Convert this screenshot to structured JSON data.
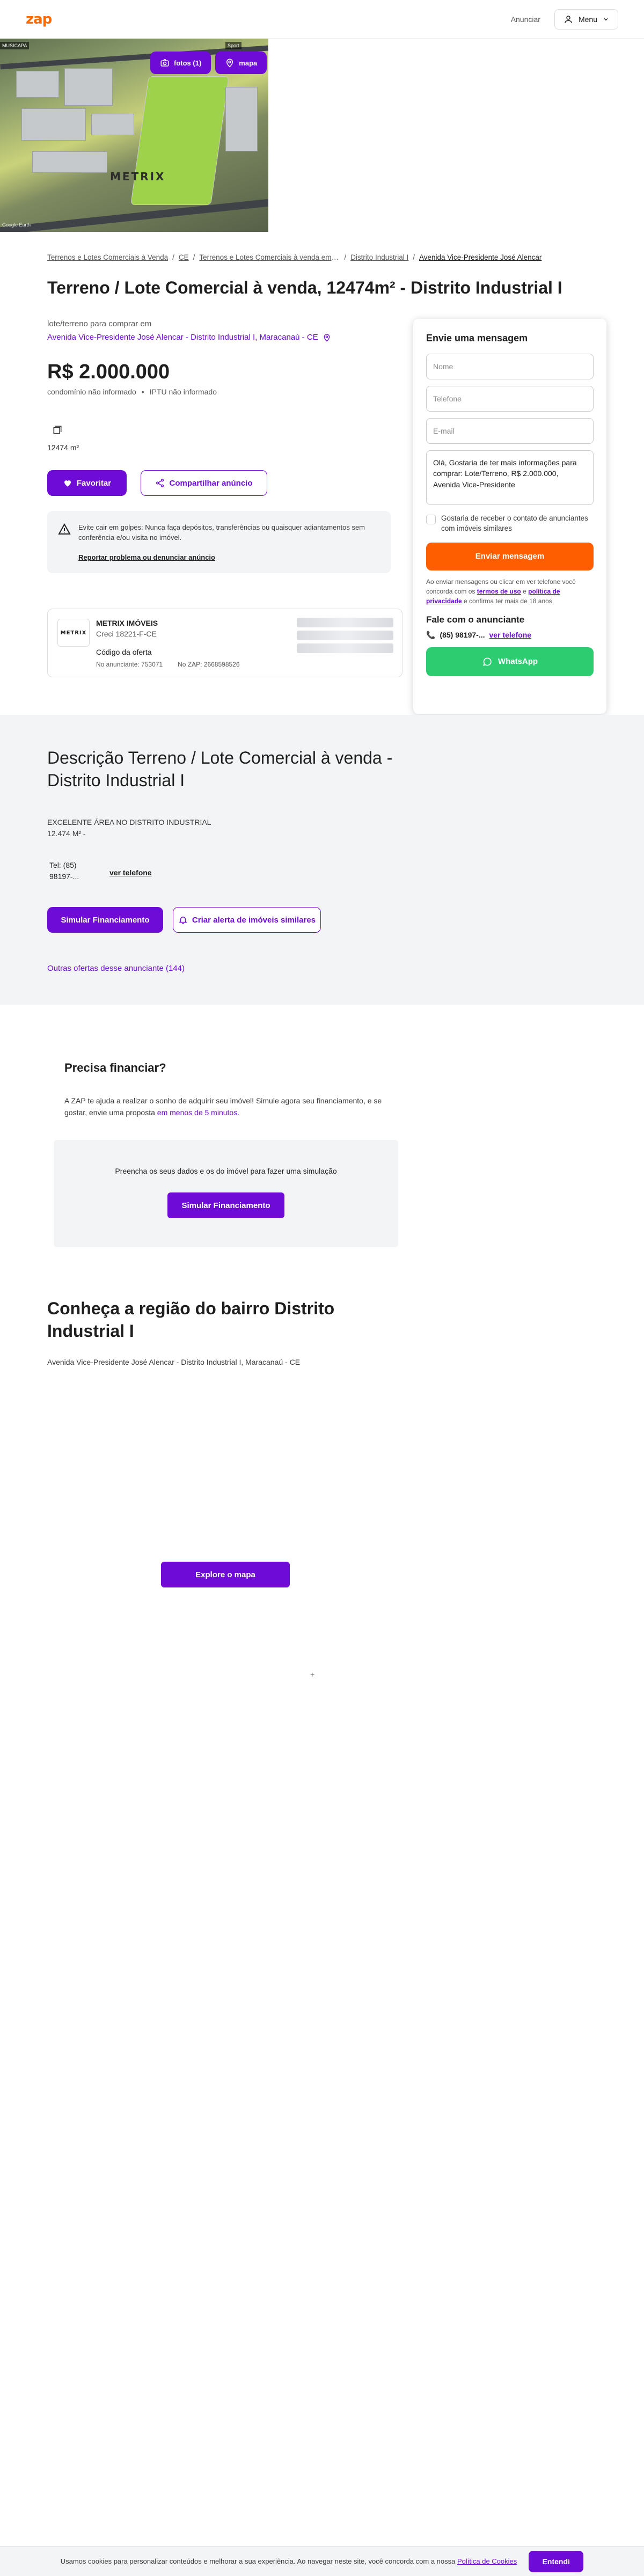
{
  "header": {
    "logo": "zap",
    "anunciar": "Anunciar",
    "menu": "Menu"
  },
  "photo": {
    "photos_button": "fotos (1)",
    "map_button": "mapa",
    "watermark": "METRIX",
    "corner_tag": "MUSICAPA",
    "corner_tag2": "Sport",
    "credit": "Google Earth"
  },
  "breadcrumb": [
    "Terrenos e Lotes Comerciais à Venda",
    "CE",
    "Terrenos e Lotes Comerciais à venda em Maracanaú",
    "Distrito Industrial I",
    "Avenida Vice-Presidente José Alencar"
  ],
  "breadcrumb_sep": "/",
  "listing": {
    "title": "Terreno / Lote Comercial à venda, 12474m² - Distrito Industrial I",
    "subtitle": "lote/terreno para comprar em",
    "address": "Avenida Vice-Presidente José Alencar - Distrito Industrial I, Maracanaú - CE",
    "price": "R$ 2.000.000",
    "condo": "condomínio não informado",
    "iptu": "IPTU não informado",
    "area": "12474 m²",
    "favorite": "Favoritar",
    "share": "Compartilhar anúncio"
  },
  "warning": {
    "text": "Evite cair em golpes: Nunca faça depósitos, transferências ou quaisquer adiantamentos sem conferência e/ou visita no imóvel.",
    "report": "Reportar problema ou denunciar anúncio"
  },
  "advertiser": {
    "logo": "METRIX",
    "name": "METRIX IMÓVEIS",
    "creci": "Creci 18221-F-CE",
    "code_label": "Código da oferta",
    "listing_code": "No anunciante: 753071",
    "zap_code": "No ZAP: 2668598526"
  },
  "contact": {
    "title": "Envie uma mensagem",
    "name_placeholder": "Nome",
    "phone_placeholder": "Telefone",
    "email_placeholder": "E-mail",
    "message": "Olá, Gostaria de ter mais informações para comprar: Lote/Terreno, R$ 2.000.000, Avenida Vice-Presidente",
    "similar_opt_in": "Gostaria de receber o contato de anunciantes com imóveis similares",
    "send": "Enviar mensagem",
    "legal_1": "Ao enviar mensagens ou clicar em ver telefone você concorda com os",
    "terms": "termos de uso",
    "legal_and": "e",
    "privacy": "política de privacidade",
    "legal_2": "e confirma ter mais de 18 anos.",
    "talk_title": "Fale com o anunciante",
    "phone": "(85) 98197-...",
    "see_phone": "ver telefone",
    "whatsapp": "WhatsApp"
  },
  "description": {
    "title": "Descrição Terreno / Lote Comercial à venda - Distrito Industrial I",
    "line1": "EXCELENTE ÁREA NO DISTRITO INDUSTRIAL",
    "line2": "12.474 M² -",
    "tel_label": "Tel: (85)",
    "tel_value": "98197-...",
    "see_phone": "ver telefone",
    "simulate": "Simular Financiamento",
    "alert": "Criar alerta de imóveis similares",
    "other_offers": "Outras ofertas desse anunciante (144)"
  },
  "financing": {
    "title": "Precisa financiar?",
    "text": "A ZAP te ajuda a realizar o sonho de adquirir seu imóvel! Simule agora seu financiamento, e se gostar, envie uma proposta",
    "highlight": "em menos de 5 minutos.",
    "box_text": "Preencha os seus dados e os do imóvel para fazer uma simulação",
    "simulate": "Simular Financiamento"
  },
  "region": {
    "title": "Conheça a região do bairro Distrito Industrial I",
    "address": "Avenida Vice-Presidente José Alencar - Distrito Industrial I, Maracanaú - CE",
    "explore": "Explore o mapa",
    "plus": "+"
  },
  "cookies": {
    "text": "Usamos cookies para personalizar conteúdos e melhorar a sua experiência. Ao navegar neste site, você concorda com a nossa",
    "link": "Política de Cookies",
    "accept": "Entendi"
  },
  "colors": {
    "brand_purple": "#6f0bd6",
    "brand_orange": "#ff5e00",
    "whatsapp_green": "#2ecc71"
  }
}
